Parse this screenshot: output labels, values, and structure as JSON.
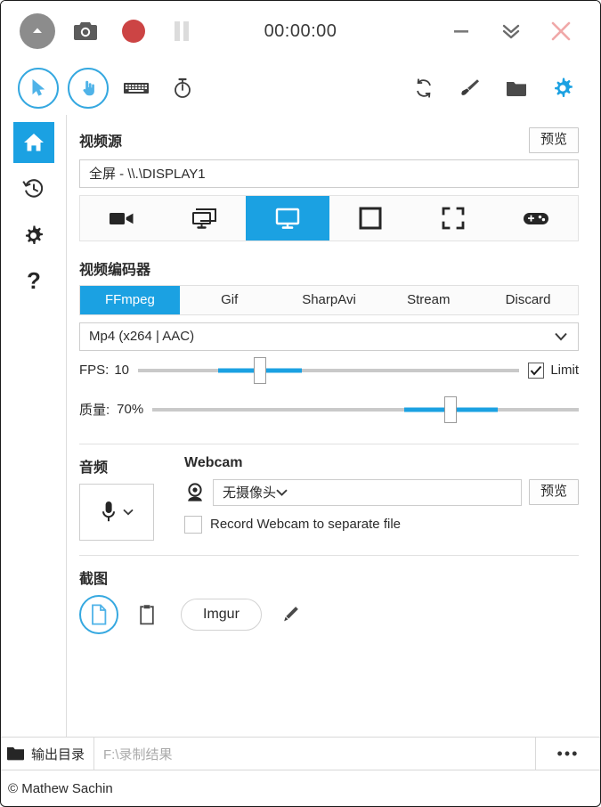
{
  "titlebar": {
    "expand_label": "expand-arrow",
    "screenshot_label": "camera",
    "record_label": "record",
    "pause_label": "pause",
    "timer": "00:00:00",
    "minimize_label": "minimize",
    "tray_label": "minimize-to-tray",
    "close_label": "close",
    "record_color": "#cc4444",
    "close_color": "#f0a8a8"
  },
  "toolbar": {
    "cursor_label": "Cursor",
    "clicks_label": "Mouse Clicks",
    "keystrokes_label": "Keystrokes",
    "timer_label": "Timer",
    "refresh_label": "Refresh",
    "brush_label": "Screenshot Editor",
    "folder_label": "Open Output Folder",
    "settings_label": "Settings",
    "accent": "#1ba1e2"
  },
  "sidebar": {
    "items": [
      {
        "name": "home",
        "label": "主页",
        "active": true
      },
      {
        "name": "history",
        "label": "历史记录",
        "active": false
      },
      {
        "name": "settings",
        "label": "设置",
        "active": false
      },
      {
        "name": "about",
        "label": "关于",
        "active": false
      }
    ]
  },
  "video_source": {
    "title": "视频源",
    "preview_button": "预览",
    "selected": "全屏 - \\\\.\\DISPLAY1",
    "source_types": [
      {
        "name": "no-video",
        "selected": false
      },
      {
        "name": "desktop-duplication",
        "selected": false
      },
      {
        "name": "screen",
        "selected": true
      },
      {
        "name": "window",
        "selected": false
      },
      {
        "name": "region",
        "selected": false
      },
      {
        "name": "game",
        "selected": false
      }
    ]
  },
  "video_encoder": {
    "title": "视频编码器",
    "tabs": [
      {
        "label": "FFmpeg",
        "active": true
      },
      {
        "label": "Gif",
        "active": false
      },
      {
        "label": "SharpAvi",
        "active": false
      },
      {
        "label": "Stream",
        "active": false
      },
      {
        "label": "Discard",
        "active": false
      }
    ],
    "codec": "Mp4 (x264 | AAC)",
    "fps_label": "FPS:",
    "fps_value": "10",
    "fps_percent": 32,
    "limit_label": "Limit",
    "limit_checked": true,
    "quality_label": "质量:",
    "quality_value": "70%",
    "quality_percent": 70
  },
  "audio": {
    "title": "音频",
    "device_icon": "microphone"
  },
  "webcam": {
    "title": "Webcam",
    "selected": "无摄像头",
    "preview_button": "预览",
    "separate_file_label": "Record Webcam to separate file",
    "separate_file_checked": false
  },
  "screenshot": {
    "title": "截图",
    "targets": [
      {
        "name": "disk",
        "selected": true
      },
      {
        "name": "clipboard",
        "selected": false
      }
    ],
    "imgur_label": "Imgur",
    "editor_label": "editor"
  },
  "output": {
    "folder_label": "输出目录",
    "path": "F:\\录制结果",
    "more_label": "•••"
  },
  "footer": {
    "copyright": "© Mathew Sachin"
  }
}
